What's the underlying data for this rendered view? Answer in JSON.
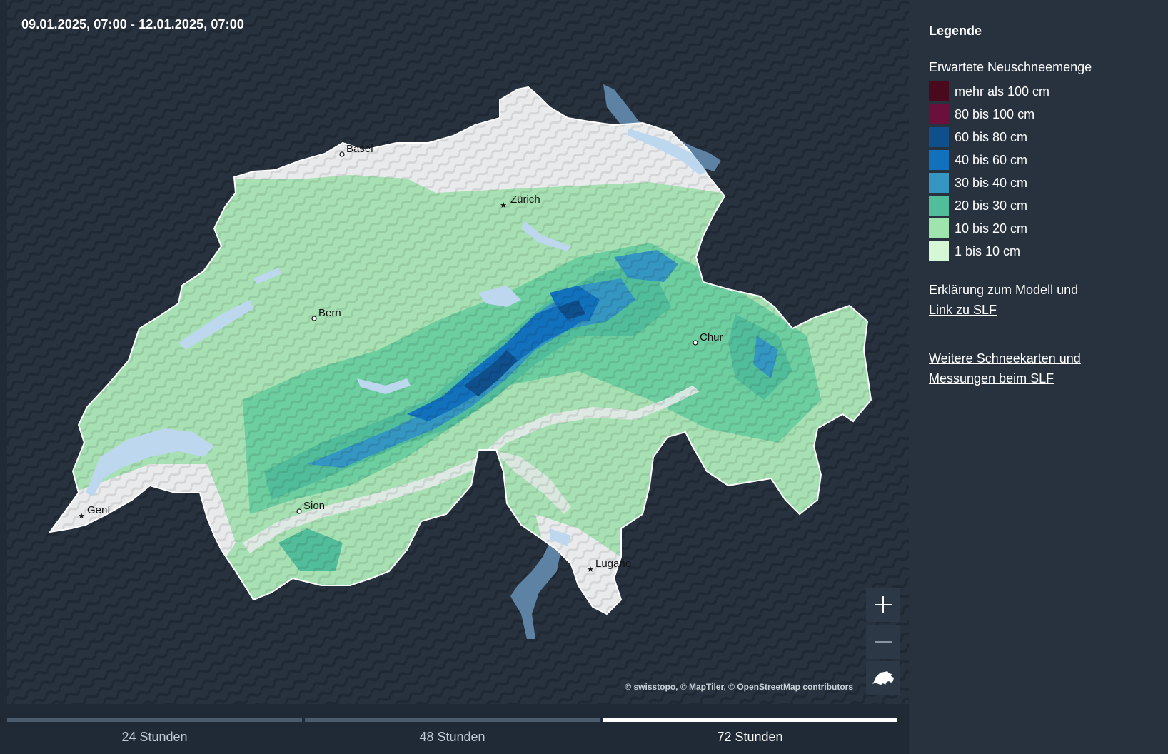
{
  "map": {
    "date_range": "09.01.2025, 07:00 - 12.01.2025, 07:00",
    "attribution": "© swisstopo, © MapTiler, © OpenStreetMap contributors",
    "cities": [
      {
        "name": "Basel",
        "marker": "circle"
      },
      {
        "name": "Zürich",
        "marker": "star"
      },
      {
        "name": "Bern",
        "marker": "circle"
      },
      {
        "name": "Chur",
        "marker": "circle"
      },
      {
        "name": "Genf",
        "marker": "star"
      },
      {
        "name": "Sion",
        "marker": "circle"
      },
      {
        "name": "Lugano",
        "marker": "star"
      }
    ],
    "controls": {
      "zoom_in_icon": "plus-icon",
      "zoom_out_icon": "minus-icon",
      "reset_icon": "switzerland-shape-icon"
    }
  },
  "timebar": {
    "tabs": [
      {
        "label": "24 Stunden",
        "active": false
      },
      {
        "label": "48 Stunden",
        "active": false
      },
      {
        "label": "72 Stunden",
        "active": true
      }
    ]
  },
  "legend": {
    "title": "Legende",
    "subtitle": "Erwartete Neuschneemenge",
    "items": [
      {
        "label": "mehr als 100 cm",
        "color": "#4a0a1e"
      },
      {
        "label": "80 bis 100 cm",
        "color": "#6b0f3c"
      },
      {
        "label": "60 bis 80 cm",
        "color": "#0e4f8c"
      },
      {
        "label": "40 bis 60 cm",
        "color": "#1271bd"
      },
      {
        "label": "30 bis 40 cm",
        "color": "#3596c2"
      },
      {
        "label": "20 bis 30 cm",
        "color": "#52bd9a"
      },
      {
        "label": "10 bis 20 cm",
        "color": "#9fe3ad"
      },
      {
        "label": "1 bis 10 cm",
        "color": "#d6f7d6"
      }
    ],
    "model_text": "Erklärung zum Modell und",
    "model_link": "Link zu SLF",
    "more_link": "Weitere Schneekarten und Messungen beim SLF"
  },
  "colors": {
    "panel_background": "#27323e",
    "page_background": "#1f2a36",
    "lake": "#bcd7ee",
    "foreign_lake": "#5d82a3",
    "no_snow": "#e9eaec"
  }
}
